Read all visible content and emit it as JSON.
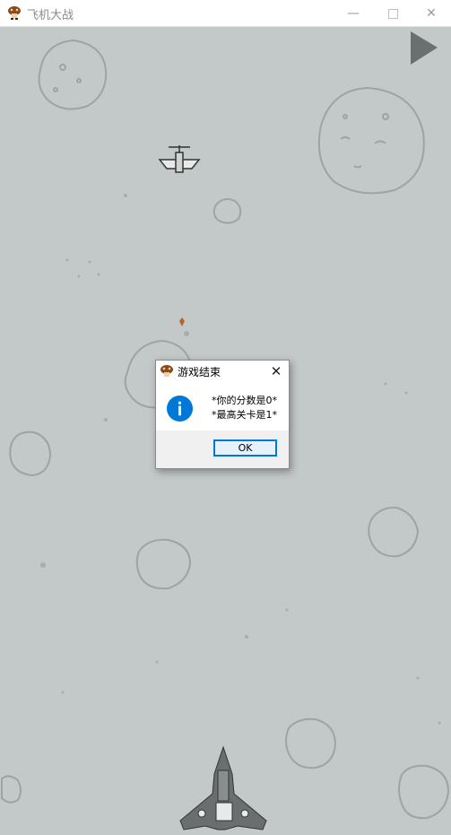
{
  "window": {
    "title": "飞机大战",
    "minimize_glyph": "—",
    "close_glyph": "✕",
    "icon": "mushroom-icon"
  },
  "game": {
    "play_button_icon": "play-triangle-icon",
    "background_color": "#c3c8c8"
  },
  "dialog": {
    "title": "游戏结束",
    "icon": "info-icon",
    "close_glyph": "✕",
    "line1": "*你的分数是0*",
    "line2": "*最高关卡是1*",
    "ok_label": "OK",
    "accent_color": "#0078d7"
  }
}
